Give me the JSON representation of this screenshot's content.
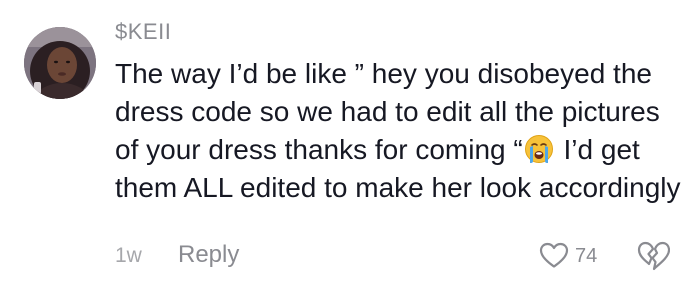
{
  "comment": {
    "username": "$KEII",
    "text_part1": "The way I’d be like ” hey you disobeyed the dress code so we had to edit all the pictures of your dress thanks for coming “",
    "emoji": "loudly-crying-face",
    "text_part2": " I’d get them ALL edited to make her look accordingly",
    "time": "1w",
    "reply_label": "Reply",
    "like_count": "74"
  },
  "colors": {
    "text": "#161823",
    "secondary": "#8a8b91"
  }
}
